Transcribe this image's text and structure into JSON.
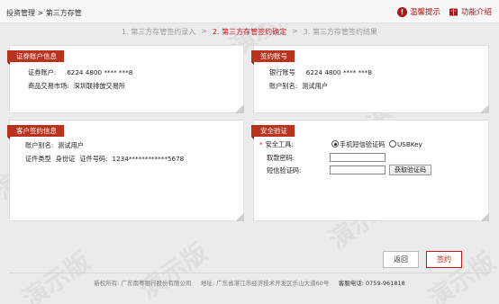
{
  "breadcrumb": "投资管理 > 第三方存管",
  "top_links": {
    "tips_label": "温馨提示",
    "intro_label": "功能介绍",
    "tips_icon": "info-icon",
    "intro_icon": "book-icon"
  },
  "steps": {
    "step1": "1. 第三方存管签约录入",
    "sep1": ">",
    "step2": "2. 第三方存管签约确定",
    "sep2": ">",
    "step3": "3. 第三方存管签约结果"
  },
  "securities_panel": {
    "title": "证券账户信息",
    "account_label": "证券账户:",
    "account_value": "6224 4800 **** ***8",
    "market_label": "商品交易市场:",
    "market_value": "深圳联排放交易所"
  },
  "bank_panel": {
    "title": "签约账号",
    "account_label": "银行账号",
    "account_value": "6224 4800 **** ***8",
    "alias_label": "账户别名:",
    "alias_value": "测试用户"
  },
  "customer_panel": {
    "title": "客户签约信息",
    "name_label": "账户别名:",
    "name_value": "测试用户",
    "id_type_label": "证件类型",
    "id_type_value": "身份证",
    "id_no_label": "证件号码:",
    "id_no_value": "1234************5678"
  },
  "security_panel": {
    "title": "安全验证",
    "tool_label": "安全工具:",
    "tool_options": [
      "手机短信验证码",
      "USBKey"
    ],
    "tool_selected": "手机短信验证码",
    "password_label": "取款密码:",
    "sms_label": "短信验证码:",
    "get_code_button": "获取验证码"
  },
  "actions": {
    "back_label": "返回",
    "sign_label": "签约"
  },
  "footer": {
    "copyright": "新权所有: 广东南粤银行股份有限公司",
    "address": "地址: 广东省湛江市经济技术开发区乐山大道60号",
    "hotline_label": "客服电话:",
    "hotline_value": "0759-961818"
  },
  "watermark": "演示版",
  "colors": {
    "accent": "#c8161d",
    "title_bg": "#b8321f"
  }
}
